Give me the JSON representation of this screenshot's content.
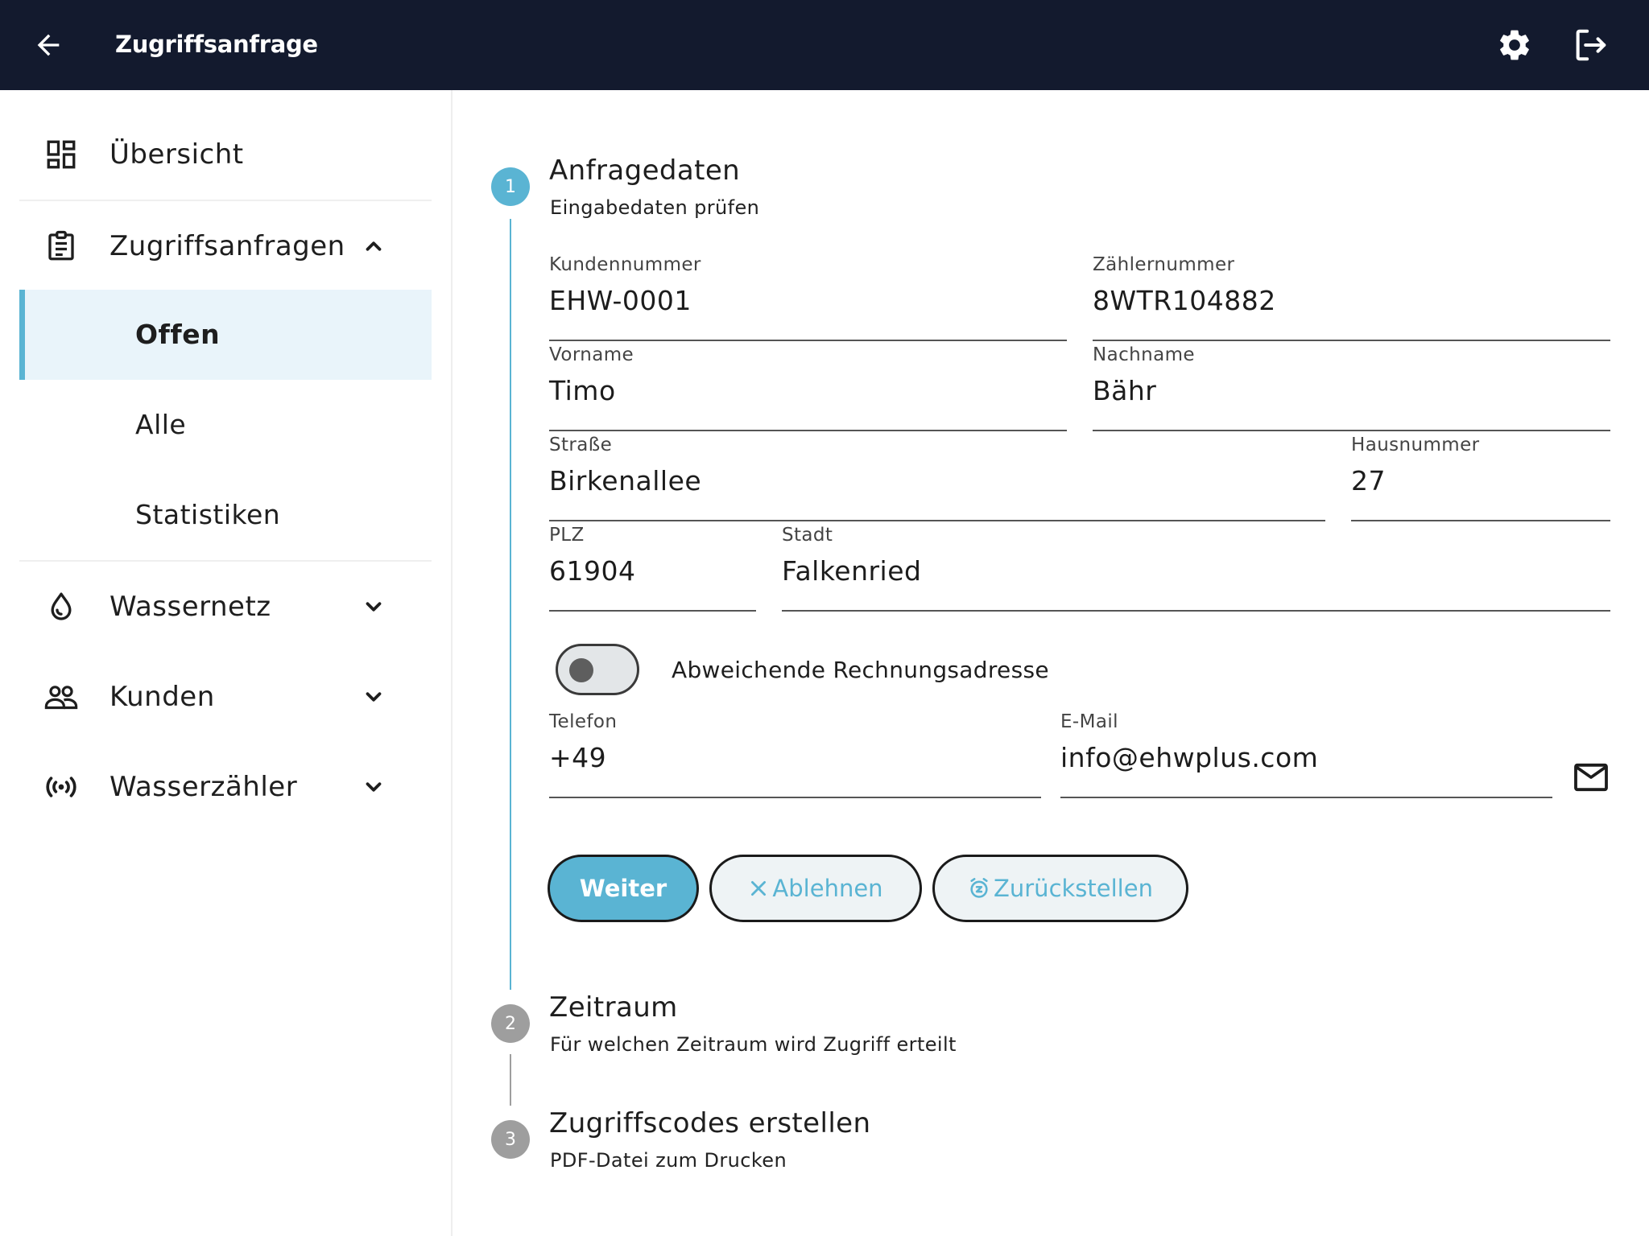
{
  "header": {
    "title": "Zugriffsanfrage"
  },
  "sidebar": {
    "items": [
      {
        "label": "Übersicht",
        "icon": "dashboard-icon"
      },
      {
        "label": "Zugriffsanfragen",
        "icon": "clipboard-icon",
        "expanded": true,
        "children": [
          {
            "label": "Offen",
            "active": true
          },
          {
            "label": "Alle"
          },
          {
            "label": "Statistiken"
          }
        ]
      },
      {
        "label": "Wassernetz",
        "icon": "water-drop-icon",
        "expanded": false
      },
      {
        "label": "Kunden",
        "icon": "people-icon",
        "expanded": false
      },
      {
        "label": "Wasserzähler",
        "icon": "sensor-icon",
        "expanded": false
      }
    ]
  },
  "stepper": {
    "steps": [
      {
        "number": "1",
        "title": "Anfragedaten",
        "subtitle": "Eingabedaten prüfen",
        "active": true
      },
      {
        "number": "2",
        "title": "Zeitraum",
        "subtitle": "Für welchen Zeitraum wird Zugriff erteilt",
        "active": false
      },
      {
        "number": "3",
        "title": "Zugriffscodes erstellen",
        "subtitle": "PDF-Datei zum Drucken",
        "active": false
      }
    ]
  },
  "form": {
    "kundennummer": {
      "label": "Kundennummer",
      "value": "EHW-0001"
    },
    "zaehlernummer": {
      "label": "Zählernummer",
      "value": "8WTR104882"
    },
    "vorname": {
      "label": "Vorname",
      "value": "Timo"
    },
    "nachname": {
      "label": "Nachname",
      "value": "Bähr"
    },
    "strasse": {
      "label": "Straße",
      "value": "Birkenallee"
    },
    "hausnummer": {
      "label": "Hausnummer",
      "value": "27"
    },
    "plz": {
      "label": "PLZ",
      "value": "61904"
    },
    "stadt": {
      "label": "Stadt",
      "value": "Falkenried"
    },
    "billing_toggle": {
      "label": "Abweichende Rechnungsadresse",
      "checked": false
    },
    "telefon": {
      "label": "Telefon",
      "value": "+49"
    },
    "email": {
      "label": "E-Mail",
      "value": "info@ehwplus.com"
    }
  },
  "actions": {
    "next_label": "Weiter",
    "reject_label": "Ablehnen",
    "postpone_label": "Zurückstellen"
  },
  "colors": {
    "topbar": "#131a2e",
    "accent": "#5ab4d3",
    "active_bg": "#e9f4fa",
    "inactive_step": "#9e9e9e"
  }
}
